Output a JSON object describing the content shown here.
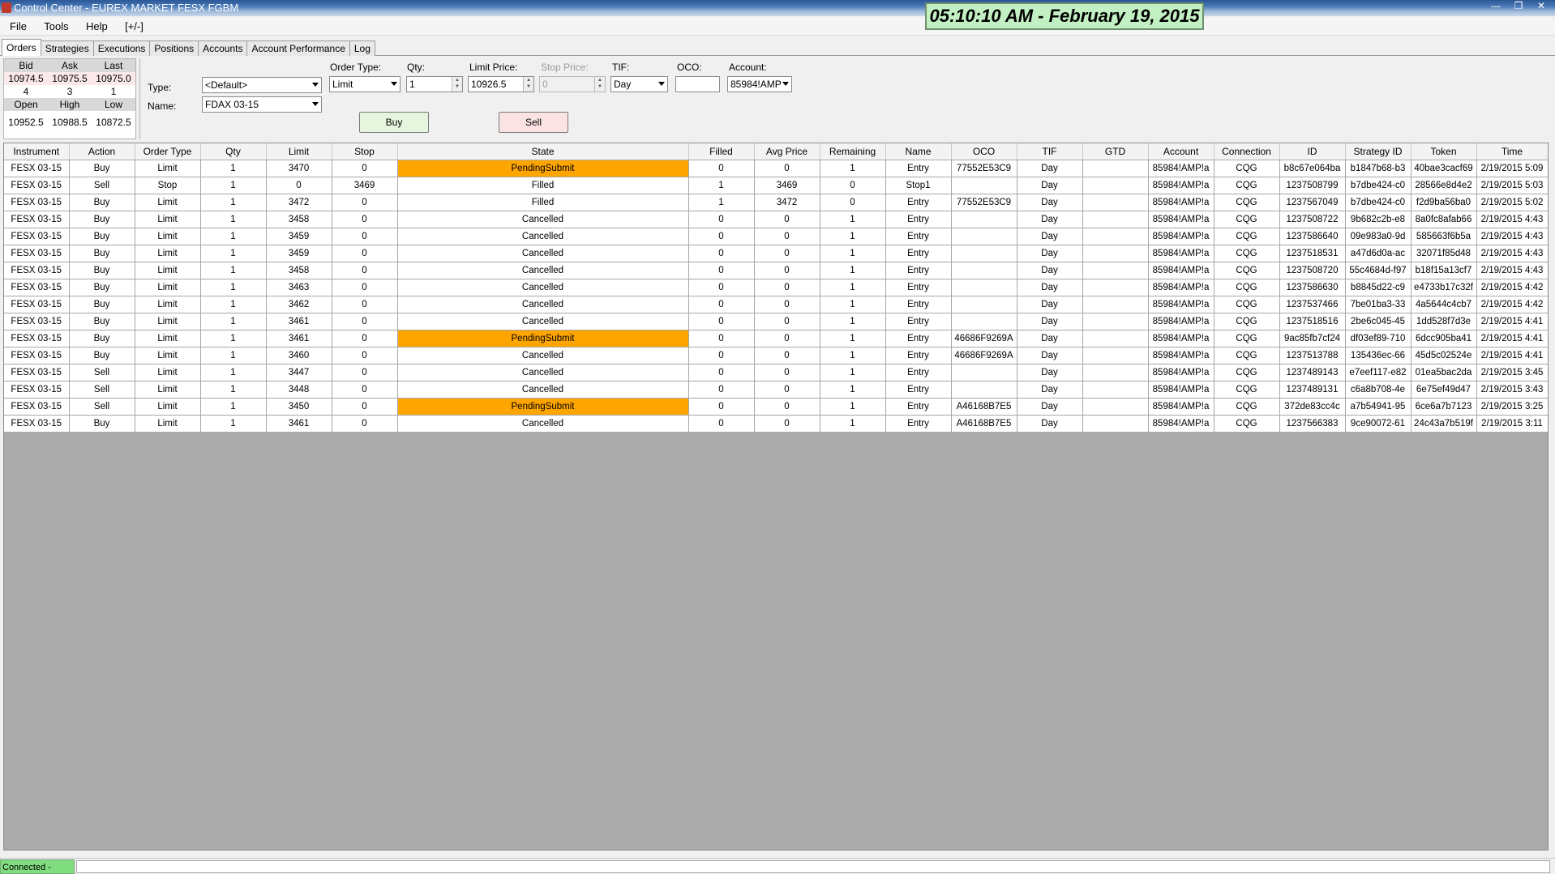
{
  "window": {
    "title": "Control Center - EUREX MARKET FESX FGBM",
    "clock": "05:10:10 AM - February 19, 2015",
    "min_glyph": "—",
    "max_glyph": "❐",
    "close_glyph": "✕"
  },
  "menu": [
    "File",
    "Tools",
    "Help",
    "[+/-]"
  ],
  "tabs": [
    "Orders",
    "Strategies",
    "Executions",
    "Positions",
    "Accounts",
    "Account Performance",
    "Log"
  ],
  "quote": {
    "headers1": [
      "Bid",
      "Ask",
      "Last"
    ],
    "values1": [
      "10974.5",
      "10975.5",
      "10975.0"
    ],
    "sizes1": [
      "4",
      "3",
      "1"
    ],
    "headers2": [
      "Open",
      "High",
      "Low"
    ],
    "values2": [
      "10952.5",
      "10988.5",
      "10872.5"
    ]
  },
  "order_entry": {
    "type_label": "Type:",
    "type_value": "<Default>",
    "name_label": "Name:",
    "name_value": "FDAX 03-15",
    "order_type_label": "Order Type:",
    "order_type_value": "Limit",
    "qty_label": "Qty:",
    "qty_value": "1",
    "limit_price_label": "Limit Price:",
    "limit_price_value": "10926.5",
    "stop_price_label": "Stop Price:",
    "stop_price_value": "0",
    "tif_label": "TIF:",
    "tif_value": "Day",
    "oco_label": "OCO:",
    "oco_value": "",
    "account_label": "Account:",
    "account_value": "85984!AMP",
    "buy_label": "Buy",
    "sell_label": "Sell"
  },
  "orders": {
    "columns": [
      "Instrument",
      "Action",
      "Order Type",
      "Qty",
      "Limit",
      "Stop",
      "State",
      "Filled",
      "Avg Price",
      "Remaining",
      "Name",
      "OCO",
      "TIF",
      "GTD",
      "Account",
      "Connection",
      "ID",
      "Strategy ID",
      "Token",
      "Time"
    ],
    "rows": [
      [
        "FESX 03-15",
        "Buy",
        "Limit",
        "1",
        "3470",
        "0",
        "PendingSubmit",
        "0",
        "0",
        "1",
        "Entry",
        "77552E53C9",
        "Day",
        "",
        "85984!AMP!a",
        "CQG",
        "b8c67e064ba",
        "b1847b68-b3",
        "40bae3cacf69",
        "2/19/2015 5:09"
      ],
      [
        "FESX 03-15",
        "Sell",
        "Stop",
        "1",
        "0",
        "3469",
        "Filled",
        "1",
        "3469",
        "0",
        "Stop1",
        "",
        "Day",
        "",
        "85984!AMP!a",
        "CQG",
        "1237508799",
        "b7dbe424-c0",
        "28566e8d4e2",
        "2/19/2015 5:03"
      ],
      [
        "FESX 03-15",
        "Buy",
        "Limit",
        "1",
        "3472",
        "0",
        "Filled",
        "1",
        "3472",
        "0",
        "Entry",
        "77552E53C9",
        "Day",
        "",
        "85984!AMP!a",
        "CQG",
        "1237567049",
        "b7dbe424-c0",
        "f2d9ba56ba0",
        "2/19/2015 5:02"
      ],
      [
        "FESX 03-15",
        "Buy",
        "Limit",
        "1",
        "3458",
        "0",
        "Cancelled",
        "0",
        "0",
        "1",
        "Entry",
        "",
        "Day",
        "",
        "85984!AMP!a",
        "CQG",
        "1237508722",
        "9b682c2b-e8",
        "8a0fc8afab66",
        "2/19/2015 4:43"
      ],
      [
        "FESX 03-15",
        "Buy",
        "Limit",
        "1",
        "3459",
        "0",
        "Cancelled",
        "0",
        "0",
        "1",
        "Entry",
        "",
        "Day",
        "",
        "85984!AMP!a",
        "CQG",
        "1237586640",
        "09e983a0-9d",
        "585663f6b5a",
        "2/19/2015 4:43"
      ],
      [
        "FESX 03-15",
        "Buy",
        "Limit",
        "1",
        "3459",
        "0",
        "Cancelled",
        "0",
        "0",
        "1",
        "Entry",
        "",
        "Day",
        "",
        "85984!AMP!a",
        "CQG",
        "1237518531",
        "a47d6d0a-ac",
        "32071f85d48",
        "2/19/2015 4:43"
      ],
      [
        "FESX 03-15",
        "Buy",
        "Limit",
        "1",
        "3458",
        "0",
        "Cancelled",
        "0",
        "0",
        "1",
        "Entry",
        "",
        "Day",
        "",
        "85984!AMP!a",
        "CQG",
        "1237508720",
        "55c4684d-f97",
        "b18f15a13cf7",
        "2/19/2015 4:43"
      ],
      [
        "FESX 03-15",
        "Buy",
        "Limit",
        "1",
        "3463",
        "0",
        "Cancelled",
        "0",
        "0",
        "1",
        "Entry",
        "",
        "Day",
        "",
        "85984!AMP!a",
        "CQG",
        "1237586630",
        "b8845d22-c9",
        "e4733b17c32f",
        "2/19/2015 4:42"
      ],
      [
        "FESX 03-15",
        "Buy",
        "Limit",
        "1",
        "3462",
        "0",
        "Cancelled",
        "0",
        "0",
        "1",
        "Entry",
        "",
        "Day",
        "",
        "85984!AMP!a",
        "CQG",
        "1237537466",
        "7be01ba3-33",
        "4a5644c4cb7",
        "2/19/2015 4:42"
      ],
      [
        "FESX 03-15",
        "Buy",
        "Limit",
        "1",
        "3461",
        "0",
        "Cancelled",
        "0",
        "0",
        "1",
        "Entry",
        "",
        "Day",
        "",
        "85984!AMP!a",
        "CQG",
        "1237518516",
        "2be6c045-45",
        "1dd528f7d3e",
        "2/19/2015 4:41"
      ],
      [
        "FESX 03-15",
        "Buy",
        "Limit",
        "1",
        "3461",
        "0",
        "PendingSubmit",
        "0",
        "0",
        "1",
        "Entry",
        "46686F9269A",
        "Day",
        "",
        "85984!AMP!a",
        "CQG",
        "9ac85fb7cf24",
        "df03ef89-710",
        "6dcc905ba41",
        "2/19/2015 4:41"
      ],
      [
        "FESX 03-15",
        "Buy",
        "Limit",
        "1",
        "3460",
        "0",
        "Cancelled",
        "0",
        "0",
        "1",
        "Entry",
        "46686F9269A",
        "Day",
        "",
        "85984!AMP!a",
        "CQG",
        "1237513788",
        "135436ec-66",
        "45d5c02524e",
        "2/19/2015 4:41"
      ],
      [
        "FESX 03-15",
        "Sell",
        "Limit",
        "1",
        "3447",
        "0",
        "Cancelled",
        "0",
        "0",
        "1",
        "Entry",
        "",
        "Day",
        "",
        "85984!AMP!a",
        "CQG",
        "1237489143",
        "e7eef117-e82",
        "01ea5bac2da",
        "2/19/2015 3:45"
      ],
      [
        "FESX 03-15",
        "Sell",
        "Limit",
        "1",
        "3448",
        "0",
        "Cancelled",
        "0",
        "0",
        "1",
        "Entry",
        "",
        "Day",
        "",
        "85984!AMP!a",
        "CQG",
        "1237489131",
        "c6a8b708-4e",
        "6e75ef49d47",
        "2/19/2015 3:43"
      ],
      [
        "FESX 03-15",
        "Sell",
        "Limit",
        "1",
        "3450",
        "0",
        "PendingSubmit",
        "0",
        "0",
        "1",
        "Entry",
        "A46168B7E5",
        "Day",
        "",
        "85984!AMP!a",
        "CQG",
        "372de83cc4c",
        "a7b54941-95",
        "6ce6a7b7123",
        "2/19/2015 3:25"
      ],
      [
        "FESX 03-15",
        "Buy",
        "Limit",
        "1",
        "3461",
        "0",
        "Cancelled",
        "0",
        "0",
        "1",
        "Entry",
        "A46168B7E5",
        "Day",
        "",
        "85984!AMP!a",
        "CQG",
        "1237566383",
        "9ce90072-61",
        "24c43a7b519f",
        "2/19/2015 3:11"
      ]
    ]
  },
  "status": {
    "connection": "Connected - CQG"
  },
  "colors": {
    "pending": "#ffa500",
    "clock_bg": "#c3f0c3",
    "connected": "#7fdc7f",
    "buy_btn": "#e6f5dd",
    "sell_btn": "#fbe3e4"
  }
}
